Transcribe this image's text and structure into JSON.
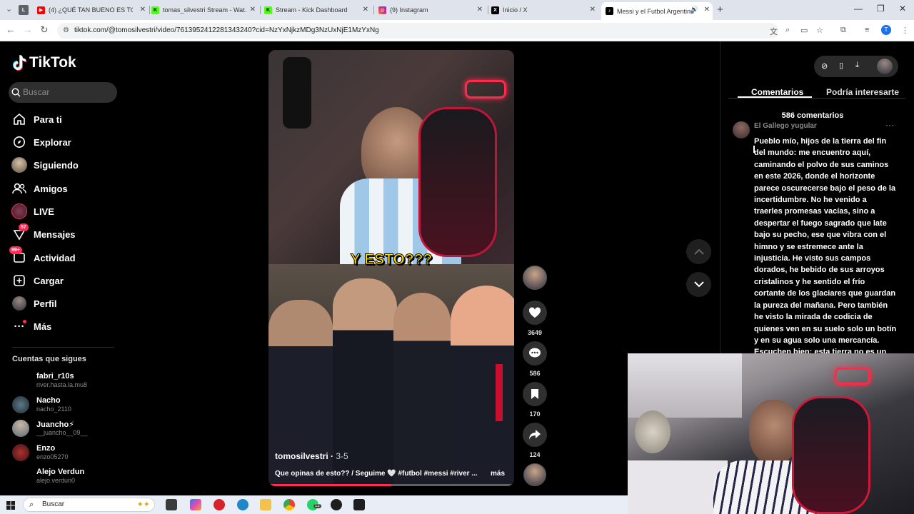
{
  "browser": {
    "tabs": [
      {
        "title": "L",
        "icon": "profile-l-icon"
      },
      {
        "title": "(4) ¿QUÉ TAN BUENO ES TOMA…",
        "icon": "youtube-icon",
        "color": "#ff0000"
      },
      {
        "title": "tomas_silvestri Stream - Wat…",
        "icon": "kick-icon",
        "color": "#53fc18"
      },
      {
        "title": "Stream - Kick Dashboard",
        "icon": "kick-icon",
        "color": "#53fc18"
      },
      {
        "title": "(9) Instagram",
        "icon": "instagram-icon",
        "color": "#e1306c"
      },
      {
        "title": "Inicio / X",
        "icon": "x-icon",
        "color": "#000000"
      },
      {
        "title": "Messi y el Futbol Argentino",
        "icon": "tiktok-icon",
        "color": "#000000"
      }
    ],
    "url": "tiktok.com/@tomosilvestri/video/7613952412281343240?cid=NzYxNjkzMDg3NzUxNjE1MzYxNg",
    "profile_initial": "T"
  },
  "sidebar": {
    "logo": "TikTok",
    "search_placeholder": "Buscar",
    "menu": [
      {
        "label": "Para ti",
        "icon": "home-icon"
      },
      {
        "label": "Explorar",
        "icon": "compass-icon"
      },
      {
        "label": "Siguiendo",
        "icon": "following-avatar-icon"
      },
      {
        "label": "Amigos",
        "icon": "friends-icon"
      },
      {
        "label": "LIVE",
        "icon": "live-avatar-icon"
      },
      {
        "label": "Mensajes",
        "icon": "messages-icon",
        "badge": "57"
      },
      {
        "label": "Actividad",
        "icon": "activity-icon",
        "badge": "99+"
      },
      {
        "label": "Cargar",
        "icon": "upload-icon"
      },
      {
        "label": "Perfil",
        "icon": "profile-avatar-icon"
      },
      {
        "label": "Más",
        "icon": "more-dots-icon"
      }
    ],
    "following_title": "Cuentas que sigues",
    "following": [
      {
        "name": "fabri_r10s",
        "user": "river.hasta.la.mu8"
      },
      {
        "name": "Nacho",
        "user": "nacho_2110"
      },
      {
        "name": "Juancho⚡",
        "user": "__juancho__09__"
      },
      {
        "name": "Enzo",
        "user": "enzo05270"
      },
      {
        "name": "Alejo Verdun",
        "user": "alejo.verdun0"
      }
    ]
  },
  "video": {
    "caption": "Y ESTO???",
    "author": "tomosilvestri",
    "date": "3-5",
    "description": "Que opinas de esto?? / Seguime 🤍 #futbol #messi #river ...",
    "more": "más",
    "progress": 0.5
  },
  "actions": {
    "likes": "3649",
    "comments": "586",
    "saves": "170",
    "shares": "124"
  },
  "panel": {
    "tabs": [
      "Comentarios",
      "Podría interesarte"
    ],
    "count": "586 comentarios",
    "comment_user": "El Gallego yugular",
    "comment_text": "Pueblo mío, hijos de la tierra del fin del mundo: me encuentro aquí, caminando el polvo de sus caminos en este 2026, donde el horizonte parece oscurecerse bajo el peso de la incertidumbre. No he venido a traerles promesas vacías, sino a despertar el fuego sagrado que late bajo su pecho, ese que vibra con el himno y se estremece ante la injusticia. He visto sus campos dorados, he bebido de sus arroyos cristalinos y he sentido el frío cortante de los glaciares que guardan la pureza del mañana. Pero también he visto la mirada de codicia de quienes ven en su suelo solo un botín y en su agua solo una mercancía. Escuchen bien: esta tierra no es un"
  },
  "taskbar": {
    "search": "Buscar",
    "whatsapp_badge": "12"
  }
}
